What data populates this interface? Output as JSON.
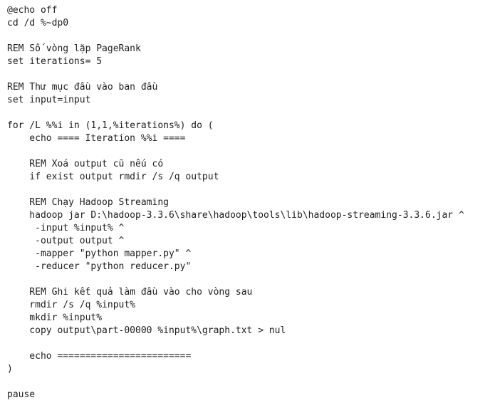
{
  "code": {
    "lines": [
      "@echo off",
      "cd /d %~dp0",
      "",
      "REM Số vòng lặp PageRank",
      "set iterations= 5",
      "",
      "REM Thư mục đầu vào ban đầu",
      "set input=input",
      "",
      "for /L %%i in (1,1,%iterations%) do (",
      "    echo ==== Iteration %%i ====",
      "",
      "    REM Xoá output cũ nếu có",
      "    if exist output rmdir /s /q output",
      "",
      "    REM Chạy Hadoop Streaming",
      "    hadoop jar D:\\hadoop-3.3.6\\share\\hadoop\\tools\\lib\\hadoop-streaming-3.3.6.jar ^",
      "     -input %input% ^",
      "     -output output ^",
      "     -mapper \"python mapper.py\" ^",
      "     -reducer \"python reducer.py\"",
      "",
      "    REM Ghi kết quả làm đầu vào cho vòng sau",
      "    rmdir /s /q %input%",
      "    mkdir %input%",
      "    copy output\\part-00000 %input%\\graph.txt > nul",
      "",
      "    echo ========================",
      ")",
      "",
      "pause"
    ]
  }
}
